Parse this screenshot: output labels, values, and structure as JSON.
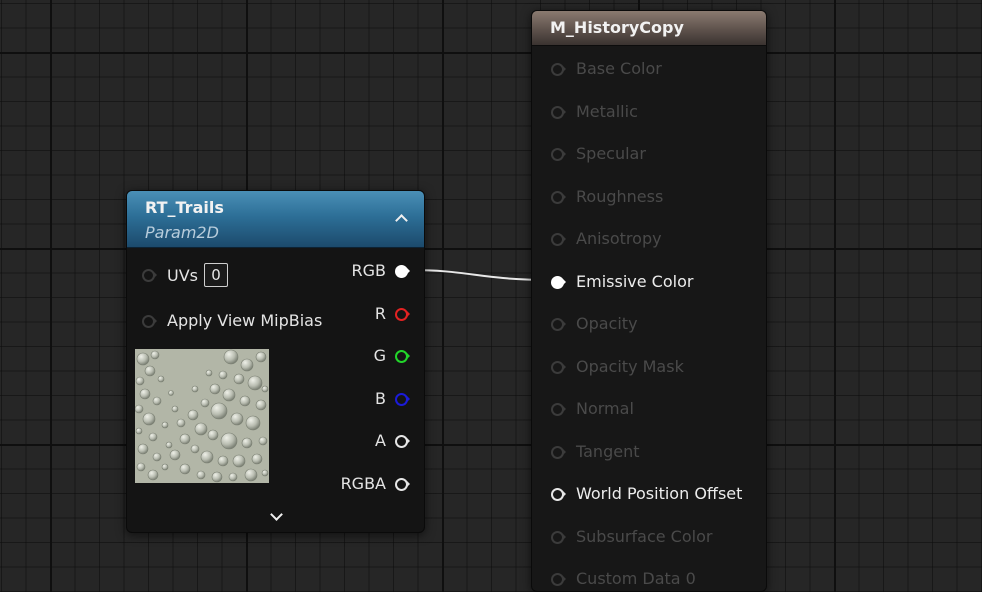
{
  "rt_node": {
    "title": "RT_Trails",
    "subtitle": "Param2D",
    "inputs": [
      {
        "label": "UVs",
        "value": "0"
      },
      {
        "label": "Apply View MipBias"
      }
    ],
    "outputs": [
      {
        "label": "RGB",
        "color": "#ffffff",
        "connected": true
      },
      {
        "label": "R",
        "color": "#e32222"
      },
      {
        "label": "G",
        "color": "#22d52a"
      },
      {
        "label": "B",
        "color": "#1b1bd8"
      },
      {
        "label": "A",
        "color": "#e6e6e6"
      },
      {
        "label": "RGBA",
        "color": "#e6e6e6"
      }
    ],
    "thumbnail_icon": "texture-thumbnail"
  },
  "material_node": {
    "title": "M_HistoryCopy",
    "inputs": [
      {
        "label": "Base Color"
      },
      {
        "label": "Metallic"
      },
      {
        "label": "Specular"
      },
      {
        "label": "Roughness"
      },
      {
        "label": "Anisotropy"
      },
      {
        "label": "Emissive Color",
        "connected": true
      },
      {
        "label": "Opacity"
      },
      {
        "label": "Opacity Mask"
      },
      {
        "label": "Normal"
      },
      {
        "label": "Tangent"
      },
      {
        "label": "World Position Offset"
      },
      {
        "label": "Subsurface Color"
      },
      {
        "label": "Custom Data 0"
      }
    ]
  },
  "colors": {
    "rt_header": "#2d6f97",
    "material_header": "#5e524c",
    "background": "#262626",
    "wire": "#e8e8e8"
  }
}
